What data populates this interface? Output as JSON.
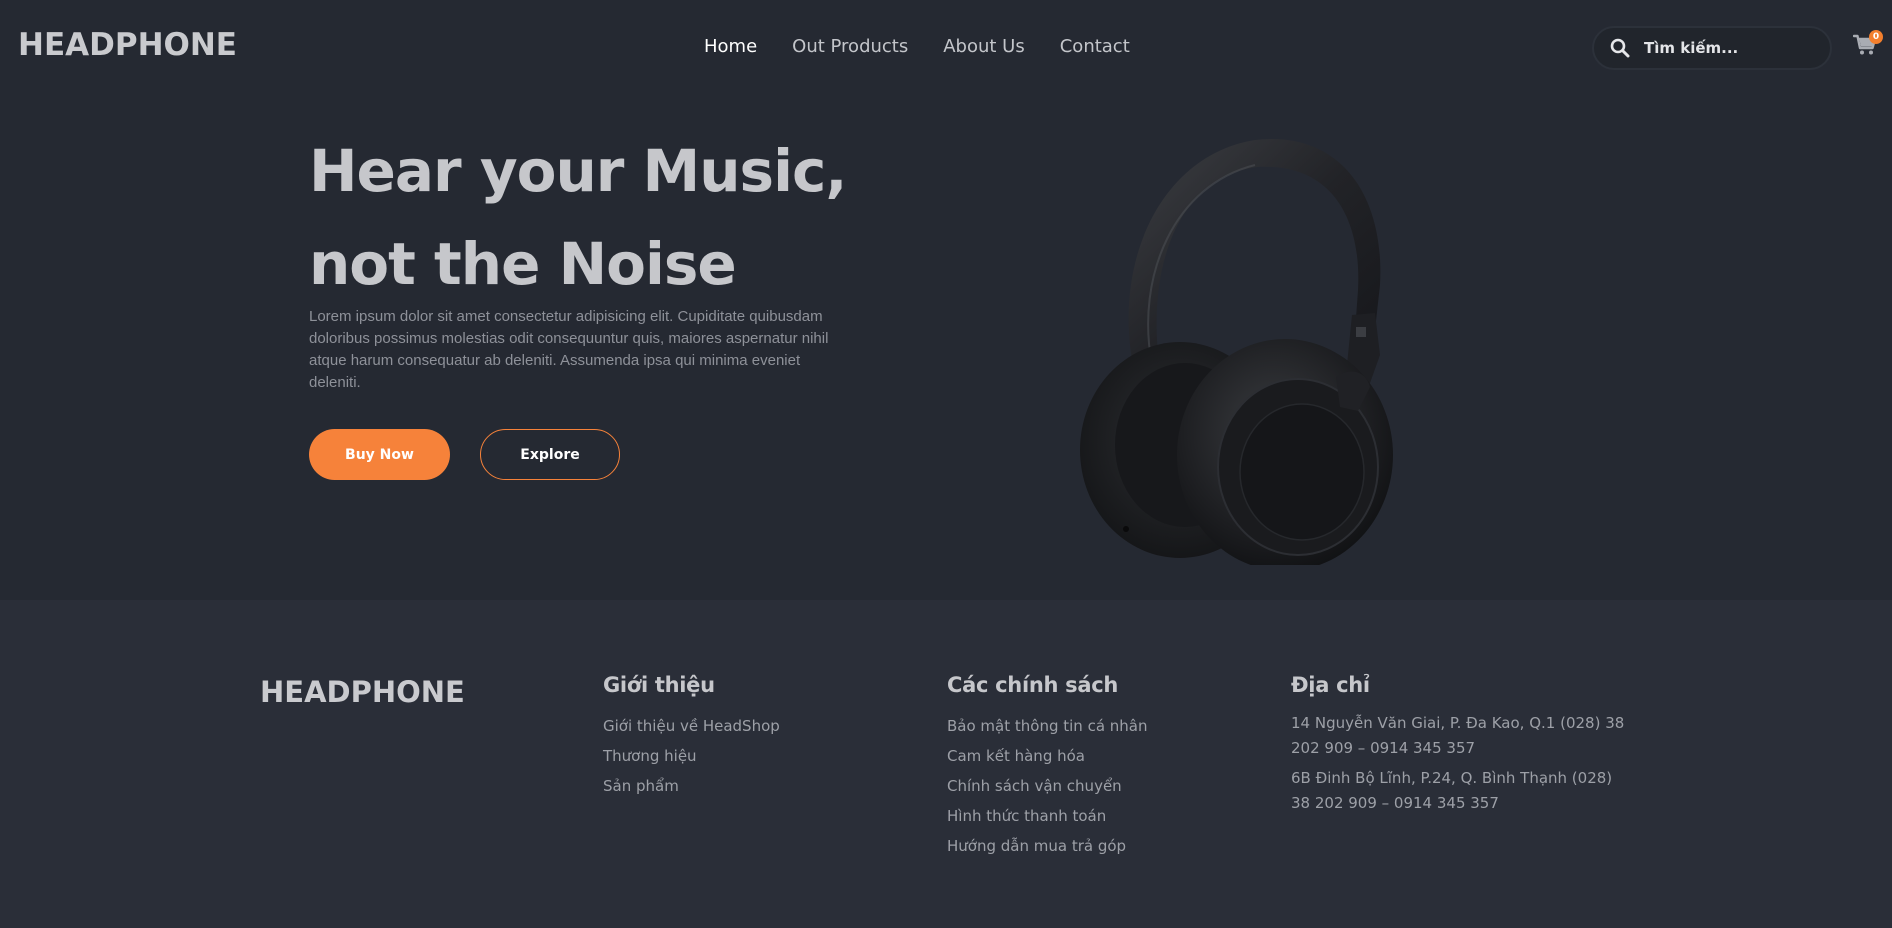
{
  "header": {
    "logo": "HEADPHONE",
    "nav": [
      {
        "label": "Home",
        "active": true
      },
      {
        "label": "Out Products",
        "active": false
      },
      {
        "label": "About Us",
        "active": false
      },
      {
        "label": "Contact",
        "active": false
      }
    ],
    "search_placeholder": "Tìm kiếm...",
    "search_icon": "search-icon",
    "cart_icon": "cart-icon",
    "cart_count": "0"
  },
  "hero": {
    "title": "Hear your Music, not the Noise",
    "description": "Lorem ipsum dolor sit amet consectetur adipisicing elit. Cupiditate quibusdam doloribus possimus molestias odit consequuntur quis, maiores aspernatur nihil atque harum consequatur ab deleniti. Assumenda ipsa qui minima eveniet deleniti.",
    "buy_label": "Buy Now",
    "explore_label": "Explore",
    "image": "headphone-product-image"
  },
  "footer": {
    "logo": "HEADPHONE",
    "about": {
      "heading": "Giới thiệu",
      "links": [
        "Giới thiệu về HeadShop",
        "Thương hiệu",
        "Sản phẩm"
      ]
    },
    "policy": {
      "heading": "Các chính sách",
      "links": [
        "Bảo mật thông tin cá nhân",
        "Cam kết hàng hóa",
        "Chính sách vận chuyển",
        "Hình thức thanh toán",
        "Hướng dẫn mua trả góp"
      ]
    },
    "address": {
      "heading": "Địa chỉ",
      "lines": [
        "14 Nguyễn Văn Giai, P. Đa Kao, Q.1 (028) 38 202 909 – 0914 345 357",
        "6B Đinh Bộ Lĩnh, P.24, Q. Bình Thạnh (028) 38 202 909 – 0914 345 357"
      ]
    }
  },
  "colors": {
    "background": "#252932",
    "footer_background": "#2a2e38",
    "accent": "#f6823a",
    "text_light": "#c6c7cb",
    "text_muted": "#8e9199"
  }
}
